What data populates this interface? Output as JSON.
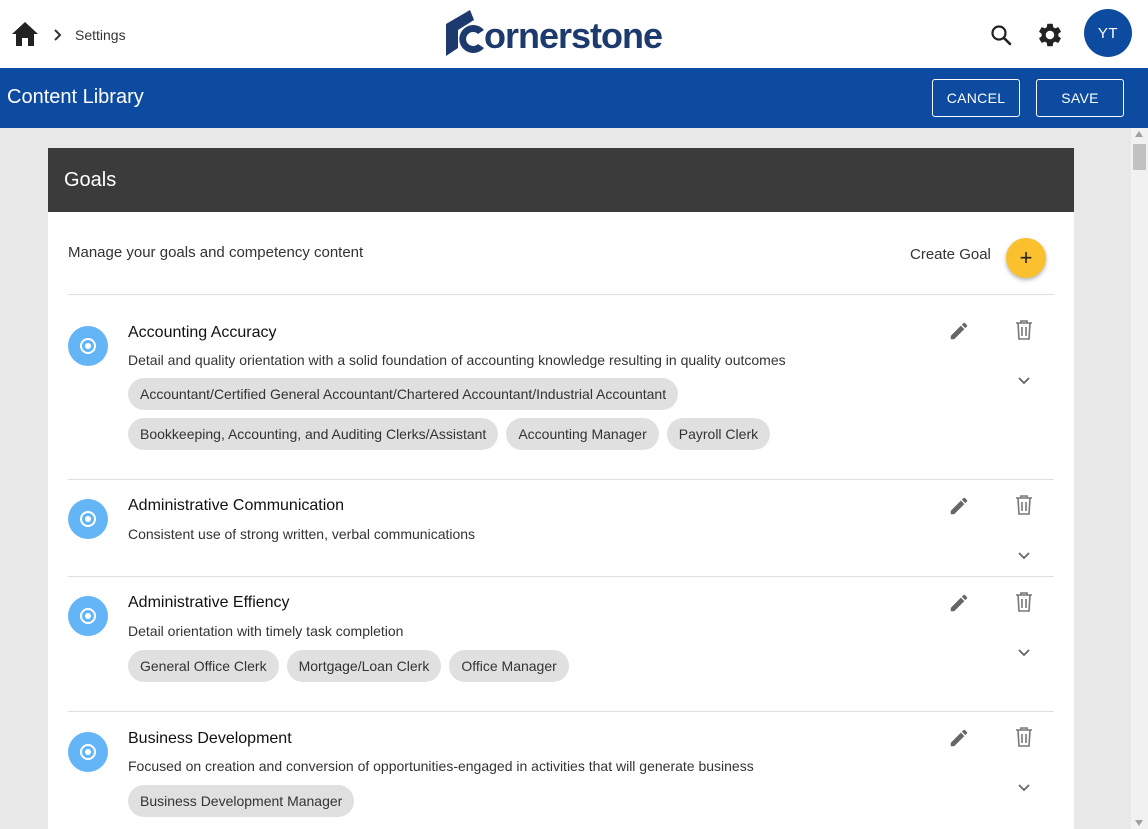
{
  "topbar": {
    "breadcrumb": "Settings",
    "logo_text": "cornerstone",
    "avatar_initials": "YT",
    "icons": [
      "home-icon",
      "chevron-right-icon",
      "search-icon",
      "gear-icon"
    ]
  },
  "header": {
    "title": "Content Library",
    "cancel_label": "CANCEL",
    "save_label": "SAVE",
    "color": "#0d4ba0"
  },
  "card": {
    "title": "Goals",
    "description": "Manage your goals and competency content",
    "create_label": "Create Goal",
    "create_icon": "+"
  },
  "goals": [
    {
      "title": "Accounting Accuracy",
      "description": "Detail and quality orientation with a solid foundation of accounting knowledge resulting in quality outcomes",
      "tags": [
        "Accountant/Certified General Accountant/Chartered Accountant/Industrial Accountant",
        "Bookkeeping, Accounting, and Auditing Clerks/Assistant",
        "Accounting Manager",
        "Payroll Clerk"
      ]
    },
    {
      "title": "Administrative Communication",
      "description": "Consistent use of strong written, verbal communications",
      "tags": []
    },
    {
      "title": "Administrative Effiency",
      "description": "Detail orientation with timely task completion",
      "tags": [
        "General Office Clerk",
        "Mortgage/Loan Clerk",
        "Office Manager"
      ]
    },
    {
      "title": "Business Development",
      "description": "Focused on creation and conversion of opportunities-engaged in activities that will generate business",
      "tags": [
        "Business Development Manager"
      ]
    }
  ],
  "colors": {
    "accent": "#fbc02d",
    "goal_icon": "#64b5f6",
    "card_header": "#3b3b3b"
  }
}
